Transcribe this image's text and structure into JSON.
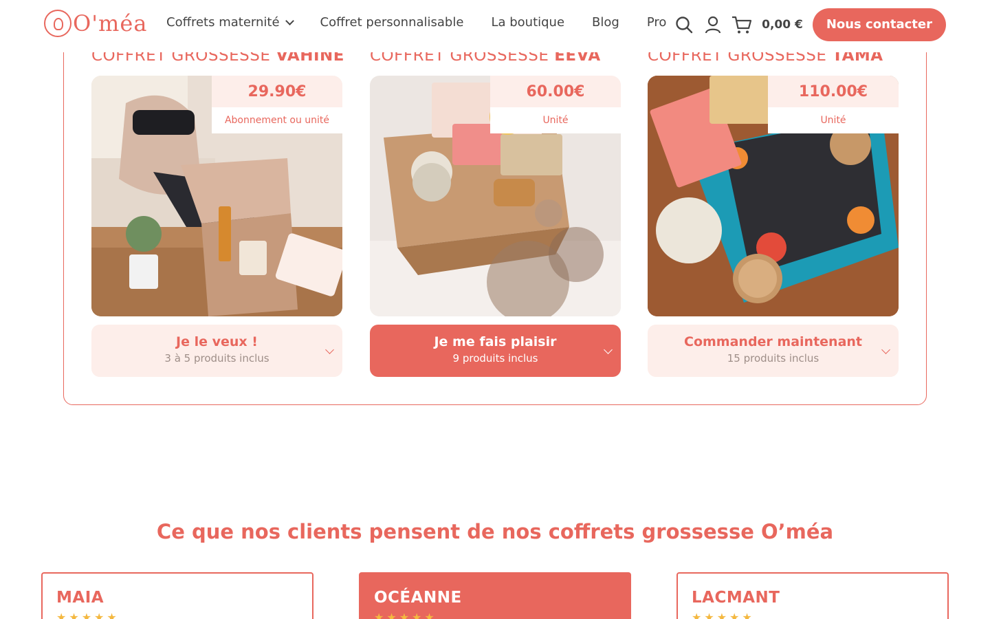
{
  "header": {
    "logo_text": "O'méa",
    "nav": [
      {
        "label": "Coffrets maternité",
        "has_dropdown": true
      },
      {
        "label": "Coffret personnalisable"
      },
      {
        "label": "La boutique"
      },
      {
        "label": "Blog"
      },
      {
        "label": "Pro"
      }
    ],
    "cart_total": "0,00 €",
    "contact_label": "Nous contacter"
  },
  "colors": {
    "accent": "#e8675d",
    "accent_light": "#fdeeea",
    "text": "#444444",
    "star": "#f4b840"
  },
  "products": [
    {
      "title_prefix": "COFFRET GROSSESSE ",
      "title_name": "VAHINE",
      "price": "29.90€",
      "price_sub": "Abonnement ou unité",
      "cta_main": "Je le veux !",
      "cta_sub": "3 à 5 produits inclus",
      "cta_filled": false
    },
    {
      "title_prefix": "COFFRET GROSSESSE ",
      "title_name": "EEVA",
      "price": "60.00€",
      "price_sub": "Unité",
      "cta_main": "Je me fais plaisir",
      "cta_sub": "9 produits inclus",
      "cta_filled": true
    },
    {
      "title_prefix": "COFFRET GROSSESSE ",
      "title_name": "TAMA",
      "price": "110.00€",
      "price_sub": "Unité",
      "cta_main": "Commander maintenant",
      "cta_sub": "15 produits inclus",
      "cta_filled": false
    }
  ],
  "reviews": {
    "title": "Ce que nos clients pensent de nos coffrets grossesse O’méa",
    "cards": [
      {
        "name": "MAIA",
        "stars": 5
      },
      {
        "name": "OCÉANNE",
        "stars": 5
      },
      {
        "name": "LACMANT",
        "stars": 5
      }
    ],
    "star_glyph": "★★★★★"
  }
}
